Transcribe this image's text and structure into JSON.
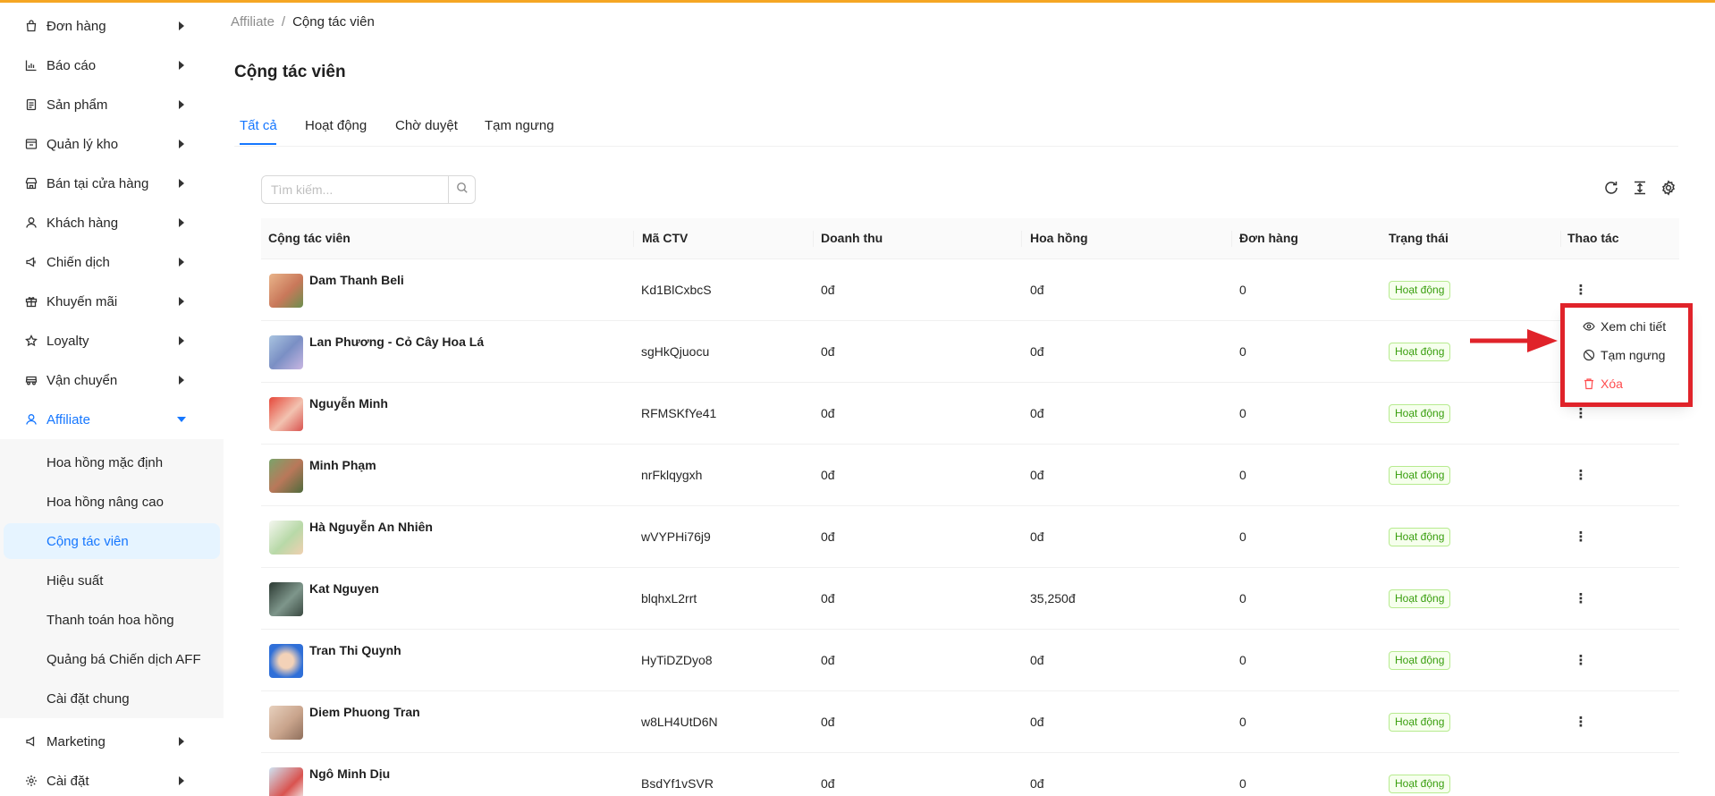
{
  "colors": {
    "accent_top": "#f5a623",
    "primary": "#1677ff",
    "status_green": "#389e0d",
    "danger": "#ff4d4f",
    "annotation_red": "#e0232a"
  },
  "sidebar": {
    "items": [
      {
        "label": "Đơn hàng",
        "icon": "bag-icon"
      },
      {
        "label": "Báo cáo",
        "icon": "bar-chart-icon"
      },
      {
        "label": "Sản phẩm",
        "icon": "document-icon"
      },
      {
        "label": "Quản lý kho",
        "icon": "warehouse-icon"
      },
      {
        "label": "Bán tại cửa hàng",
        "icon": "store-icon"
      },
      {
        "label": "Khách hàng",
        "icon": "customer-icon"
      },
      {
        "label": "Chiến dịch",
        "icon": "megaphone-icon"
      },
      {
        "label": "Khuyến mãi",
        "icon": "gift-icon"
      },
      {
        "label": "Loyalty",
        "icon": "star-icon"
      },
      {
        "label": "Vận chuyển",
        "icon": "truck-icon"
      },
      {
        "label": "Affiliate",
        "icon": "affiliate-icon"
      },
      {
        "label": "Marketing",
        "icon": "marketing-icon"
      },
      {
        "label": "Cài đặt",
        "icon": "gear-icon"
      }
    ],
    "affiliate_sub": [
      "Hoa hồng mặc định",
      "Hoa hồng nâng cao",
      "Cộng tác viên",
      "Hiệu suất",
      "Thanh toán hoa hồng",
      "Quảng bá Chiến dịch AFF",
      "Cài đặt chung"
    ]
  },
  "breadcrumb": {
    "parent": "Affiliate",
    "separator": "/",
    "current": "Cộng tác viên"
  },
  "page_title": "Cộng tác viên",
  "tabs": [
    "Tất cả",
    "Hoạt động",
    "Chờ duyệt",
    "Tạm ngưng"
  ],
  "search": {
    "placeholder": "Tìm kiếm..."
  },
  "toolbar": {
    "icons": [
      "reload-icon",
      "column-height-icon",
      "settings-icon"
    ]
  },
  "table": {
    "columns": [
      "Cộng tác viên",
      "Mã CTV",
      "Doanh thu",
      "Hoa hồng",
      "Đơn hàng",
      "Trạng thái",
      "Thao tác"
    ],
    "rows": [
      {
        "name": "Dam Thanh Beli",
        "code": "Kd1BlCxbcS",
        "revenue": "0đ",
        "commission": "0đ",
        "orders": "0",
        "status": "Hoạt động"
      },
      {
        "name": "Lan Phương - Cỏ Cây Hoa Lá",
        "code": "sgHkQjuocu",
        "revenue": "0đ",
        "commission": "0đ",
        "orders": "0",
        "status": "Hoạt động"
      },
      {
        "name": "Nguyễn Minh",
        "code": "RFMSKfYe41",
        "revenue": "0đ",
        "commission": "0đ",
        "orders": "0",
        "status": "Hoạt động"
      },
      {
        "name": "Minh Phạm",
        "code": "nrFklqygxh",
        "revenue": "0đ",
        "commission": "0đ",
        "orders": "0",
        "status": "Hoạt động"
      },
      {
        "name": "Hà Nguyễn An Nhiên",
        "code": "wVYPHi76j9",
        "revenue": "0đ",
        "commission": "0đ",
        "orders": "0",
        "status": "Hoạt động"
      },
      {
        "name": "Kat Nguyen",
        "code": "blqhxL2rrt",
        "revenue": "0đ",
        "commission": "35,250đ",
        "orders": "0",
        "status": "Hoạt động"
      },
      {
        "name": "Tran Thi Quynh",
        "code": "HyTiDZDyo8",
        "revenue": "0đ",
        "commission": "0đ",
        "orders": "0",
        "status": "Hoạt động"
      },
      {
        "name": "Diem Phuong Tran",
        "code": "w8LH4UtD6N",
        "revenue": "0đ",
        "commission": "0đ",
        "orders": "0",
        "status": "Hoạt động"
      },
      {
        "name": "Ngô Minh Dịu",
        "code": "BsdYf1vSVR",
        "revenue": "0đ",
        "commission": "0đ",
        "orders": "0",
        "status": "Hoạt động"
      }
    ]
  },
  "action_menu": {
    "items": [
      {
        "label": "Xem chi tiết",
        "icon": "eye-icon"
      },
      {
        "label": "Tạm ngưng",
        "icon": "stop-icon"
      },
      {
        "label": "Xóa",
        "icon": "trash-icon"
      }
    ]
  }
}
